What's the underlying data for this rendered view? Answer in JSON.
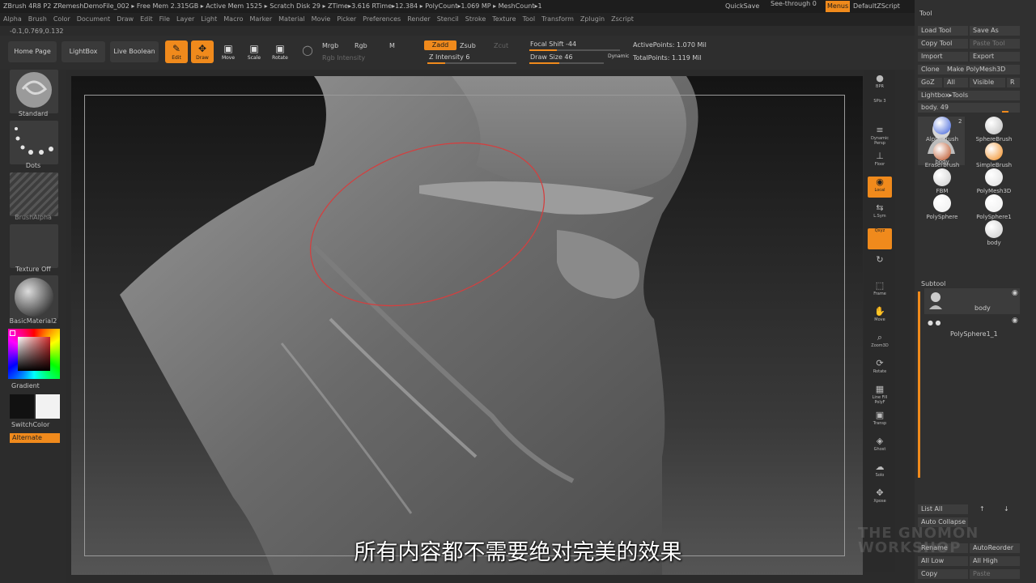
{
  "titlebar": {
    "text": "ZBrush 4R8 P2    ZRemeshDemoFile_002   ▸ Free Mem 2.315GB ▸ Active Mem 1525 ▸ Scratch Disk 29 ▸ ZTime▸3.616 RTime▸12.384 ▸ PolyCount▸1.069 MP ▸ MeshCount▸1",
    "quicksave": "QuickSave",
    "seethrough": "See-through  0",
    "menus": "Menus",
    "defaultzscript": "DefaultZScript"
  },
  "menubar": [
    "Alpha",
    "Brush",
    "Color",
    "Document",
    "Draw",
    "Edit",
    "File",
    "Layer",
    "Light",
    "Macro",
    "Marker",
    "Material",
    "Movie",
    "Picker",
    "Preferences",
    "Render",
    "Stencil",
    "Stroke",
    "Texture",
    "Tool",
    "Transform",
    "Zplugin",
    "Zscript"
  ],
  "coords": "-0.1,0.769,0.132",
  "shelf": {
    "home": "Home Page",
    "lightbox": "LightBox",
    "liveboolean": "Live Boolean",
    "edit": "Edit",
    "draw": "Draw",
    "move": "Move",
    "scale": "Scale",
    "rotate": "Rotate",
    "mrgb": "Mrgb",
    "rgb": "Rgb",
    "m": "M",
    "rgb_intensity": "Rgb Intensity",
    "zadd": "Zadd",
    "zsub": "Zsub",
    "zcut": "Zcut",
    "z_intensity": "Z Intensity 6",
    "focal_shift": "Focal Shift -44",
    "draw_size": "Draw Size 46",
    "dynamic": "Dynamic",
    "active_points": "ActivePoints: 1.070 Mil",
    "total_points": "TotalPoints: 1.119 Mil",
    "z_intensity_level": 0.2,
    "focal_shift_level": 0.3,
    "draw_size_level": 0.4
  },
  "lefttray": {
    "standard": "Standard",
    "dots": "Dots",
    "brushalpha": "BrushAlpha",
    "textureoff": "Texture Off",
    "material": "BasicMaterial2",
    "gradient": "Gradient",
    "switchcolor": "SwitchColor",
    "alternate": "Alternate"
  },
  "subtitle": "所有内容都不需要绝对完美的效果",
  "rightstrip": [
    {
      "label": "BPR",
      "glyph": "●",
      "on": false
    },
    {
      "label": "SPix 3",
      "glyph": "",
      "on": false
    },
    {
      "label": "Dynamic Persp",
      "glyph": "≡",
      "on": false
    },
    {
      "label": "Floor",
      "glyph": "⊥",
      "on": false
    },
    {
      "label": "Local",
      "glyph": "◉",
      "on": true
    },
    {
      "label": "L.Sym",
      "glyph": "⇆",
      "on": false
    },
    {
      "label": "Qxyz",
      "glyph": "",
      "on": true
    },
    {
      "label": "",
      "glyph": "↻",
      "on": false
    },
    {
      "label": "Frame",
      "glyph": "⬚",
      "on": false
    },
    {
      "label": "Move",
      "glyph": "✋",
      "on": false
    },
    {
      "label": "Zoom3D",
      "glyph": "⌕",
      "on": false
    },
    {
      "label": "Rotate",
      "glyph": "⟳",
      "on": false
    },
    {
      "label": "Line Fill PolyF",
      "glyph": "▦",
      "on": false
    },
    {
      "label": "Transp",
      "glyph": "▣",
      "on": false
    },
    {
      "label": "Ghost",
      "glyph": "◈",
      "on": false
    },
    {
      "label": "Solo",
      "glyph": "☁",
      "on": false
    },
    {
      "label": "Xpose",
      "glyph": "✥",
      "on": false
    }
  ],
  "toolpanel": {
    "title": "Tool",
    "load_tool": "Load Tool",
    "save_as": "Save As",
    "copy_tool": "Copy Tool",
    "paste_tool": "Paste Tool",
    "import": "Import",
    "export": "Export",
    "clone": "Clone",
    "make_polymesh": "Make PolyMesh3D",
    "goz": "GoZ",
    "all": "All",
    "visible": "Visible",
    "r": "R",
    "lightbox_tools": "Lightbox▸Tools",
    "body_slider": "body. 49",
    "body_count": "2",
    "brushes": [
      "body",
      "SphereBrush",
      "AlphaBrush",
      "SimpleBrush",
      "EraserBrush",
      "PolyMesh3D",
      "FBM",
      "PolySphere1",
      "PolySphere",
      "body"
    ],
    "subtool": "Subtool",
    "subtool_items": [
      "body",
      "PolySphere1_1"
    ],
    "list_all": "List All",
    "auto_collapse": "Auto Collapse",
    "rename": "Rename",
    "autoreorder": "AutoReorder",
    "all_low": "All Low",
    "all_high": "All High",
    "copy": "Copy",
    "paste": "Paste"
  },
  "watermark": "THE GNOMON WORKSHOP"
}
